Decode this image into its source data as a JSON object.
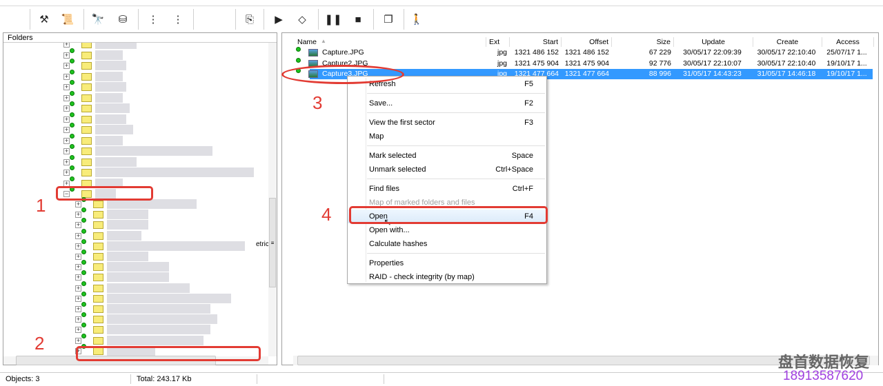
{
  "toolbar": {
    "buttons": [
      {
        "name": "tools-icon",
        "glyph": "⚒"
      },
      {
        "name": "info-scroll-icon",
        "glyph": "📜"
      },
      {
        "name": "binoculars-icon",
        "glyph": "🔭"
      },
      {
        "name": "disk-scan-icon",
        "glyph": "⛁"
      },
      {
        "name": "partition-list-icon",
        "glyph": "⋮"
      },
      {
        "name": "partition-tree-icon",
        "glyph": "⋮"
      },
      {
        "name": "export-icon",
        "glyph": "⎘"
      },
      {
        "name": "play-icon",
        "glyph": "▶"
      },
      {
        "name": "decision-tree-icon",
        "glyph": "◇"
      },
      {
        "name": "pause-icon",
        "glyph": "❚❚"
      },
      {
        "name": "stop-icon",
        "glyph": "■"
      },
      {
        "name": "windows-icon",
        "glyph": "❐"
      },
      {
        "name": "exit-icon",
        "glyph": "🚶"
      }
    ]
  },
  "folders": {
    "title": "Folders",
    "partial_text": "etric"
  },
  "files": {
    "columns": [
      "Name",
      "Ext",
      "Start",
      "Offset",
      "Size",
      "Update",
      "Create",
      "Access"
    ],
    "rows": [
      {
        "name": "Capture.JPG",
        "ext": "jpg",
        "start": "1321 486 152",
        "offset": "1321 486 152",
        "size": "67 229",
        "update": "30/05/17 22:09:39",
        "create": "30/05/17 22:10:40",
        "access": "25/07/17 1..."
      },
      {
        "name": "Capture2.JPG",
        "ext": "jpg",
        "start": "1321 475 904",
        "offset": "1321 475 904",
        "size": "92 776",
        "update": "30/05/17 22:10:07",
        "create": "30/05/17 22:10:40",
        "access": "19/10/17 1..."
      },
      {
        "name": "Capture3.JPG",
        "ext": "jpg",
        "start": "1321 477 664",
        "offset": "1321 477 664",
        "size": "88 996",
        "update": "31/05/17 14:43:23",
        "create": "31/05/17 14:46:18",
        "access": "19/10/17 1...",
        "selected": true
      }
    ]
  },
  "context_menu": {
    "items": [
      {
        "label": "Refresh",
        "key": "F5"
      },
      {
        "sep": true
      },
      {
        "label": "Save...",
        "key": "F2"
      },
      {
        "sep": true
      },
      {
        "label": "View the first sector",
        "key": "F3"
      },
      {
        "label": "Map",
        "key": ""
      },
      {
        "sep": true
      },
      {
        "label": "Mark selected",
        "key": "Space"
      },
      {
        "label": "Unmark selected",
        "key": "Ctrl+Space"
      },
      {
        "sep": true
      },
      {
        "label": "Find files",
        "key": "Ctrl+F"
      },
      {
        "label": "Map of marked folders and files",
        "key": "",
        "disabled": true
      },
      {
        "label": "Open",
        "key": "F4",
        "hover": true
      },
      {
        "label": "Open with...",
        "key": ""
      },
      {
        "label": "Calculate hashes",
        "key": ""
      },
      {
        "sep": true
      },
      {
        "label": "Properties",
        "key": ""
      },
      {
        "label": "RAID - check integrity (by map)",
        "key": ""
      }
    ]
  },
  "annotations": [
    "1",
    "2",
    "3",
    "4"
  ],
  "status": {
    "objects": "Objects: 3",
    "total": "Total: 243.17 Kb"
  },
  "watermark": {
    "title": "盘首数据恢复",
    "phone": "18913587620"
  },
  "colors": {
    "selection": "#3399ff",
    "annotation": "#e23b33",
    "watermark_phone": "#a040e0"
  }
}
